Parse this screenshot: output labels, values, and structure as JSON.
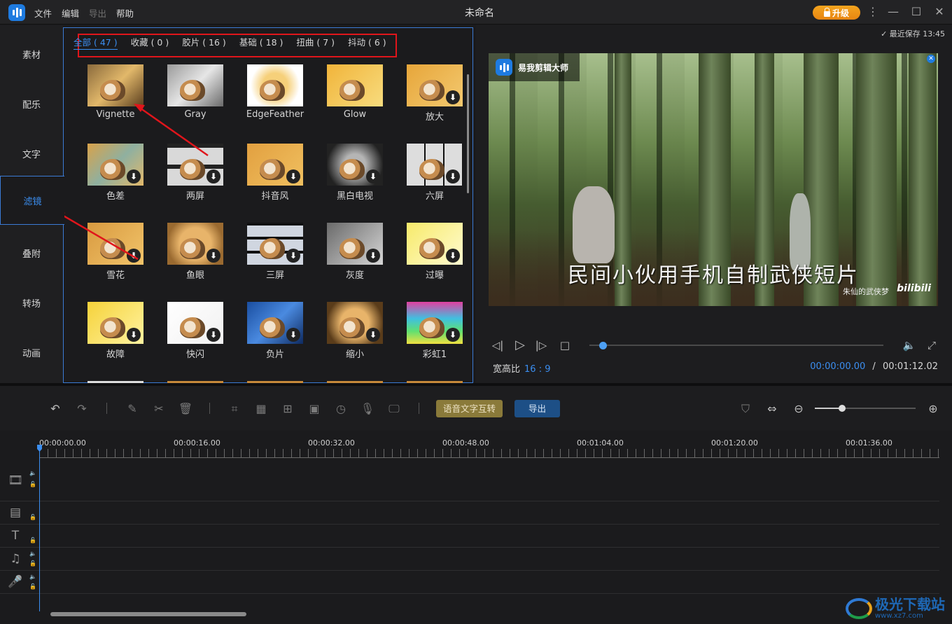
{
  "menu": [
    "文件",
    "编辑",
    "导出",
    "帮助"
  ],
  "window_title": "未命名",
  "upgrade_label": "升级",
  "left_nav": [
    "素材",
    "配乐",
    "文字",
    "滤镜",
    "叠附",
    "转场",
    "动画"
  ],
  "left_nav_active": "滤镜",
  "filter_tabs": [
    "全部 ( 47 )",
    "收藏 ( 0 )",
    "胶片 ( 16 )",
    "基础 ( 18 )",
    "扭曲 ( 7 )",
    "抖动 ( 6 )"
  ],
  "filters": [
    "Vignette",
    "Gray",
    "EdgeFeather",
    "Glow",
    "放大",
    "色差",
    "两屏",
    "抖音风",
    "黑白电视",
    "六屏",
    "雪花",
    "鱼眼",
    "三屏",
    "灰度",
    "过曝",
    "故障",
    "快闪",
    "负片",
    "缩小",
    "彩虹1"
  ],
  "preview": {
    "last_save": "最近保存 13:45",
    "brand_name": "易我剪辑大师",
    "caption": "民间小伙用手机自制武侠短片",
    "credit": "朱仙的武侠梦",
    "site_logo": "bilibili",
    "aspect_label": "宽高比",
    "aspect_value": "16 : 9",
    "current_time": "00:00:00.00",
    "separator": "/",
    "total_time": "00:01:12.02",
    "progress": 0.0
  },
  "toolbar": {
    "speech_button": "语音文字互转",
    "export_button": "导出"
  },
  "timeline": {
    "ticks": [
      "00:00:00.00",
      "00:00:16.00",
      "00:00:32.00",
      "00:00:48.00",
      "00:01:04.00",
      "00:01:20.00",
      "00:01:36.00"
    ]
  },
  "watermark": {
    "text": "极光下载站",
    "url": "www.xz7.com"
  }
}
